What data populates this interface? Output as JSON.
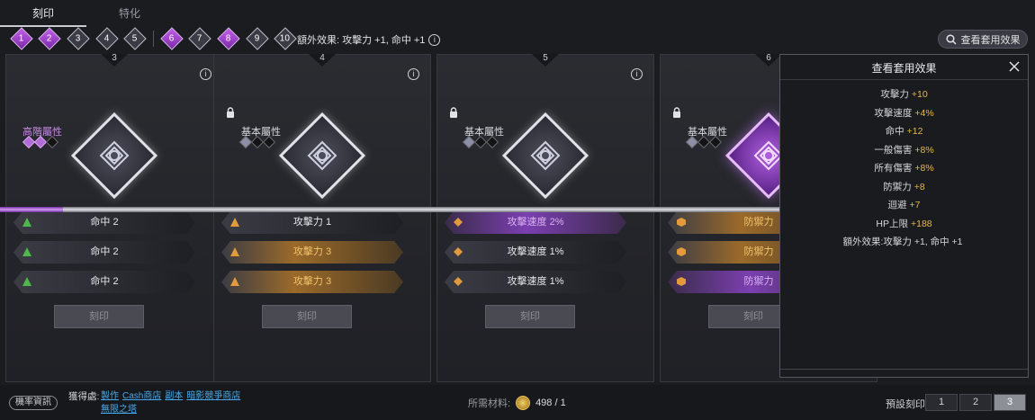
{
  "tabs": [
    {
      "label": "刻印"
    },
    {
      "label": "特化"
    }
  ],
  "gems": [
    "1",
    "2",
    "3",
    "4",
    "5",
    "6",
    "7",
    "8",
    "9",
    "10"
  ],
  "extra_effect": "額外效果: 攻擊力 +1, 命中 +1",
  "view_button": "查看套用效果",
  "cards": [
    {
      "num": "3",
      "attr": "高階屬性",
      "opts": [
        "命中 2",
        "命中 2",
        "命中 2"
      ]
    },
    {
      "num": "4",
      "attr": "基本屬性",
      "opts": [
        "攻擊力 1",
        "攻擊力 3",
        "攻擊力 3"
      ]
    },
    {
      "num": "5",
      "attr": "基本屬性",
      "opts": [
        "攻擊速度 2%",
        "攻擊速度 1%",
        "攻擊速度 1%"
      ]
    },
    {
      "num": "6",
      "attr": "基本屬性",
      "opts": [
        "防禦力",
        "防禦力",
        "防禦力"
      ]
    }
  ],
  "engrave_label": "刻印",
  "panel": {
    "title": "查看套用效果",
    "effects": [
      {
        "name": "攻擊力",
        "value": "+10"
      },
      {
        "name": "攻擊速度",
        "value": "+4%"
      },
      {
        "name": "命中",
        "value": "+12"
      },
      {
        "name": "一般傷害",
        "value": "+8%"
      },
      {
        "name": "所有傷害",
        "value": "+8%"
      },
      {
        "name": "防禦力",
        "value": "+8"
      },
      {
        "name": "迴避",
        "value": "+7"
      },
      {
        "name": "HP上限",
        "value": "+188"
      },
      {
        "name": "額外效果:攻擊力 +1, 命中 +1",
        "value": ""
      }
    ]
  },
  "bottom": {
    "prob_button": "機率資訊",
    "obtain_label": "獲得處:",
    "obtain_links": [
      "製作",
      "Cash商店",
      "副本",
      "暗影競爭商店",
      "無限之塔"
    ],
    "material_label": "所需材料:",
    "material_count": "498 / 1",
    "preset_label": "預設刻印",
    "presets": [
      "1",
      "2",
      "3"
    ]
  }
}
